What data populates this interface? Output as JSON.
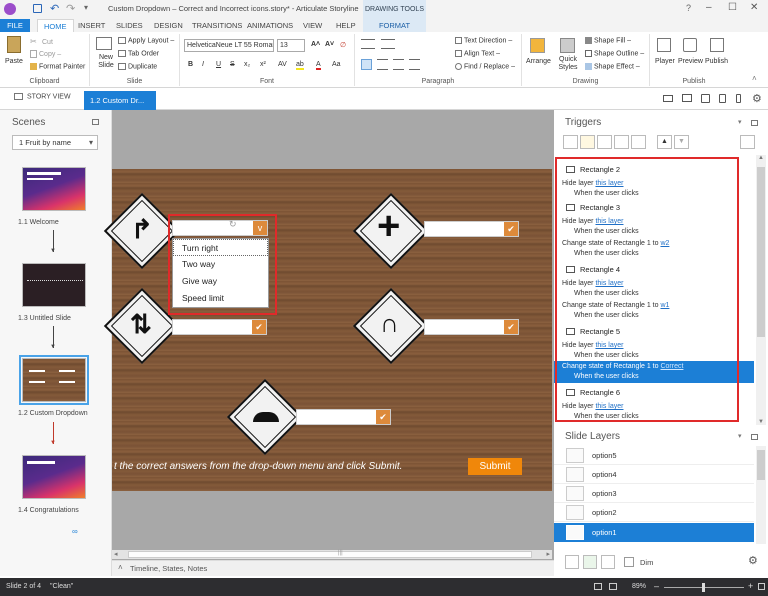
{
  "window": {
    "title": "Custom Dropdown – Correct and Incorrect icons.story* - Articulate Storyline",
    "context_tab": "DRAWING TOOLS",
    "controls": [
      "–",
      "☐",
      "✕"
    ],
    "help": "?"
  },
  "menu": {
    "file": "FILE",
    "tabs": [
      "HOME",
      "INSERT",
      "SLIDES",
      "DESIGN",
      "TRANSITIONS",
      "ANIMATIONS",
      "VIEW",
      "HELP"
    ],
    "format": "FORMAT"
  },
  "ribbon": {
    "clipboard": {
      "paste": "Paste",
      "cut": "Cut",
      "copy": "Copy –",
      "format_painter": "Format Painter",
      "label": "Clipboard"
    },
    "slide": {
      "new_slide": "New Slide",
      "apply_layout": "Apply Layout –",
      "tab_order": "Tab Order",
      "duplicate": "Duplicate",
      "label": "Slide"
    },
    "font": {
      "family": "HelveticaNeue LT 55 Roman",
      "size": "13",
      "label": "Font"
    },
    "paragraph": {
      "text_direction": "Text Direction –",
      "align_text": "Align Text –",
      "find_replace": "Find / Replace –",
      "label": "Paragraph"
    },
    "drawing": {
      "arrange": "Arrange",
      "quick_styles": "Quick Styles",
      "shape_fill": "Shape Fill –",
      "shape_outline": "Shape Outline –",
      "shape_effect": "Shape Effect –",
      "label": "Drawing"
    },
    "publish": {
      "player": "Player",
      "preview": "Preview",
      "publish": "Publish",
      "label": "Publish"
    }
  },
  "docbar": {
    "story_view": "STORY VIEW",
    "active_tab": "1.2 Custom Dr..."
  },
  "scenes": {
    "title": "Scenes",
    "filter": "1 Fruit by name",
    "slides": [
      {
        "label": "1.1 Welcome"
      },
      {
        "label": "1.3 Untitled Slide"
      },
      {
        "label": "1.2 Custom Dropdown"
      },
      {
        "label": "1.4 Congratulations"
      }
    ]
  },
  "stage": {
    "dropdown_options": [
      "Turn right",
      "Two way",
      "Give way",
      "Speed limit"
    ],
    "dropdown_selected_glyph": "v",
    "check_glyph": "✔",
    "instruction": "t the correct answers from the drop-down menu and click Submit.",
    "submit": "Submit",
    "scrollbar_glyph": "|||"
  },
  "timeline_bar": {
    "label": "Timeline, States, Notes"
  },
  "triggers": {
    "title": "Triggers",
    "groups": [
      {
        "name": "Rectangle 2",
        "items": [
          {
            "prefix": "Hide layer ",
            "link": "this layer",
            "when": "When the user clicks"
          }
        ]
      },
      {
        "name": "Rectangle 3",
        "items": [
          {
            "prefix": "Hide layer ",
            "link": "this layer",
            "when": "When the user clicks"
          },
          {
            "prefix": "Change state of Rectangle 1 to ",
            "link": "w2",
            "when": "When the user clicks"
          }
        ]
      },
      {
        "name": "Rectangle 4",
        "items": [
          {
            "prefix": "Hide layer ",
            "link": "this layer",
            "when": "When the user clicks"
          },
          {
            "prefix": "Change state of Rectangle 1 to ",
            "link": "w1",
            "when": "When the user clicks"
          }
        ]
      },
      {
        "name": "Rectangle 5",
        "items": [
          {
            "prefix": "Hide layer ",
            "link": "this layer",
            "when": "When the user clicks"
          },
          {
            "prefix": "Change state of Rectangle 1 to ",
            "link": "Correct",
            "when": "When the user clicks",
            "selected": true
          }
        ]
      },
      {
        "name": "Rectangle 6",
        "items": [
          {
            "prefix": "Hide layer ",
            "link": "this layer",
            "when": "When the user clicks"
          }
        ]
      }
    ]
  },
  "layers": {
    "title": "Slide Layers",
    "items": [
      "option5",
      "option4",
      "option3",
      "option2",
      "option1"
    ],
    "dim": "Dim"
  },
  "status": {
    "slide": "Slide 2 of 4",
    "theme": "\"Clean\"",
    "zoom": "89%"
  },
  "colors": {
    "accent": "#1c7fd6",
    "submit": "#f0870a",
    "check": "#dd8a3b",
    "highlight": "#e02a2a"
  }
}
